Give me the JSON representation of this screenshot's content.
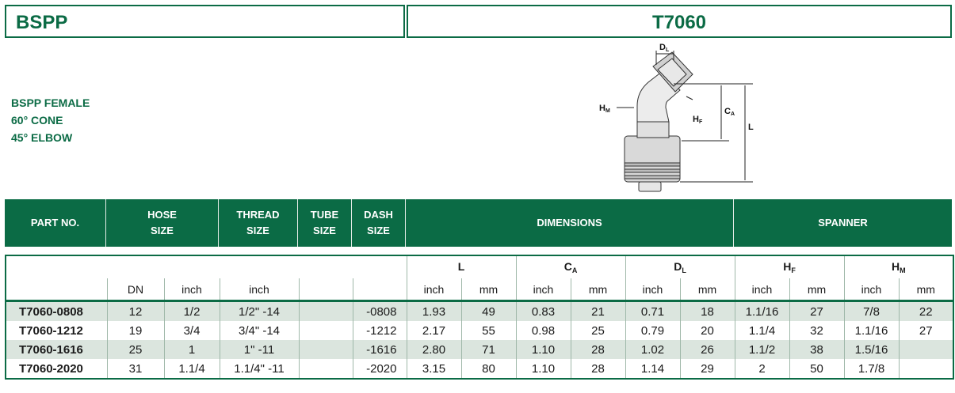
{
  "header": {
    "left_title": "BSPP",
    "right_title": "T7060"
  },
  "description": [
    "BSPP FEMALE",
    "60° CONE",
    "45° ELBOW"
  ],
  "drawing": {
    "label_dl": "D",
    "label_dl_sub": "L",
    "label_hm": "H",
    "label_hm_sub": "M",
    "label_hf": "H",
    "label_hf_sub": "F",
    "label_ca": "C",
    "label_ca_sub": "A",
    "label_l": "L"
  },
  "band": {
    "part_no": "PART NO.",
    "hose_size": [
      "HOSE",
      "SIZE"
    ],
    "thread_size": [
      "THREAD",
      "SIZE"
    ],
    "tube_size": [
      "TUBE",
      "SIZE"
    ],
    "dash_size": [
      "DASH",
      "SIZE"
    ],
    "dimensions": "DIMENSIONS",
    "spanner": "SPANNER"
  },
  "table": {
    "groups": [
      {
        "label": "L",
        "sub": ""
      },
      {
        "label": "C",
        "sub": "A"
      },
      {
        "label": "D",
        "sub": "L"
      },
      {
        "label": "H",
        "sub": "F"
      },
      {
        "label": "H",
        "sub": "M"
      }
    ],
    "units": {
      "dn": "DN",
      "hose_inch": "inch",
      "thread_inch": "inch",
      "inch": "inch",
      "mm": "mm"
    },
    "rows": [
      {
        "part": "T7060-0808",
        "dn": "12",
        "hose_inch": "1/2",
        "thread": "1/2\" -14",
        "tube": "",
        "dash": "-0808",
        "l_in": "1.93",
        "l_mm": "49",
        "ca_in": "0.83",
        "ca_mm": "21",
        "dl_in": "0.71",
        "dl_mm": "18",
        "hf_in": "1.1/16",
        "hf_mm": "27",
        "hm_in": "7/8",
        "hm_mm": "22"
      },
      {
        "part": "T7060-1212",
        "dn": "19",
        "hose_inch": "3/4",
        "thread": "3/4\" -14",
        "tube": "",
        "dash": "-1212",
        "l_in": "2.17",
        "l_mm": "55",
        "ca_in": "0.98",
        "ca_mm": "25",
        "dl_in": "0.79",
        "dl_mm": "20",
        "hf_in": "1.1/4",
        "hf_mm": "32",
        "hm_in": "1.1/16",
        "hm_mm": "27"
      },
      {
        "part": "T7060-1616",
        "dn": "25",
        "hose_inch": "1",
        "thread": "1\" -11",
        "tube": "",
        "dash": "-1616",
        "l_in": "2.80",
        "l_mm": "71",
        "ca_in": "1.10",
        "ca_mm": "28",
        "dl_in": "1.02",
        "dl_mm": "26",
        "hf_in": "1.1/2",
        "hf_mm": "38",
        "hm_in": "1.5/16",
        "hm_mm": ""
      },
      {
        "part": "T7060-2020",
        "dn": "31",
        "hose_inch": "1.1/4",
        "thread": "1.1/4\" -11",
        "tube": "",
        "dash": "-2020",
        "l_in": "3.15",
        "l_mm": "80",
        "ca_in": "1.10",
        "ca_mm": "28",
        "dl_in": "1.14",
        "dl_mm": "29",
        "hf_in": "2",
        "hf_mm": "50",
        "hm_in": "1.7/8",
        "hm_mm": ""
      }
    ]
  },
  "colors": {
    "brand_green": "#0b6b45",
    "row_shade": "#dbe5de"
  }
}
